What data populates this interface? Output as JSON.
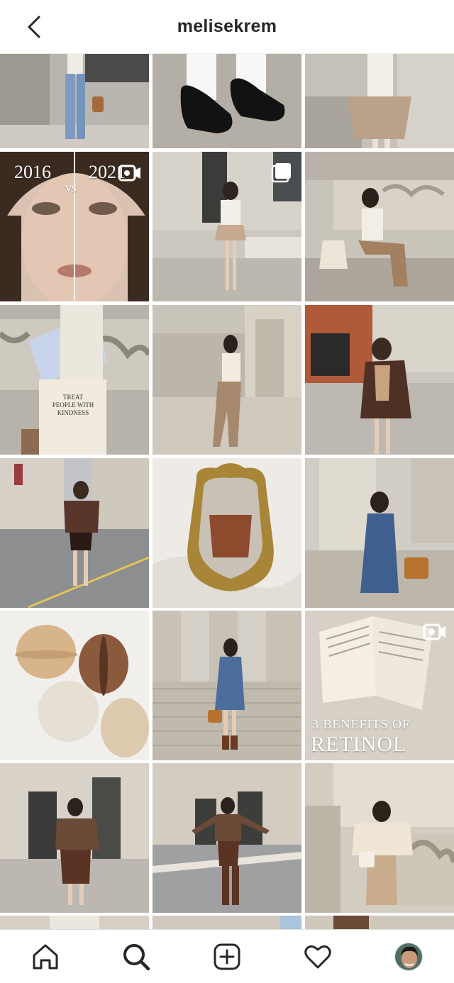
{
  "header": {
    "title": "melisekrem"
  },
  "posts": [
    {
      "id": "street-look-jeans",
      "overlay": null
    },
    {
      "id": "loafers-white-socks",
      "overlay": null
    },
    {
      "id": "plaid-skirt-steps",
      "overlay": null
    },
    {
      "id": "face-comparison",
      "overlay": "reel",
      "caption_left": "2016",
      "caption_vs": "vs",
      "caption_right": "2021"
    },
    {
      "id": "building-pleated-skirt",
      "overlay": "multi"
    },
    {
      "id": "sitting-balustrade",
      "overlay": null
    },
    {
      "id": "tote-bag",
      "overlay": null,
      "tote_text": "TREAT PEOPLE WITH KINDNESS"
    },
    {
      "id": "vest-stone-column",
      "overlay": null
    },
    {
      "id": "argyle-street",
      "overlay": null
    },
    {
      "id": "brown-jacket-street",
      "overlay": null
    },
    {
      "id": "mirror-corset",
      "overlay": null
    },
    {
      "id": "denim-dress-columns",
      "overlay": null
    },
    {
      "id": "macarons",
      "overlay": null
    },
    {
      "id": "denim-dress-stairs",
      "overlay": null
    },
    {
      "id": "retinol-book",
      "overlay": "reel",
      "caption_small": "3 BENEFITS OF",
      "caption_big": "RETINOL"
    },
    {
      "id": "argyle-sweater-building",
      "overlay": null
    },
    {
      "id": "argyle-knee-boots",
      "overlay": null
    },
    {
      "id": "cardigan-balustrade",
      "overlay": null
    }
  ],
  "nav": {
    "items": [
      "home",
      "search",
      "create",
      "activity",
      "profile"
    ],
    "active": "search"
  },
  "colors": {
    "text": "#262626",
    "border": "#dbdbdb",
    "background": "#ffffff"
  }
}
